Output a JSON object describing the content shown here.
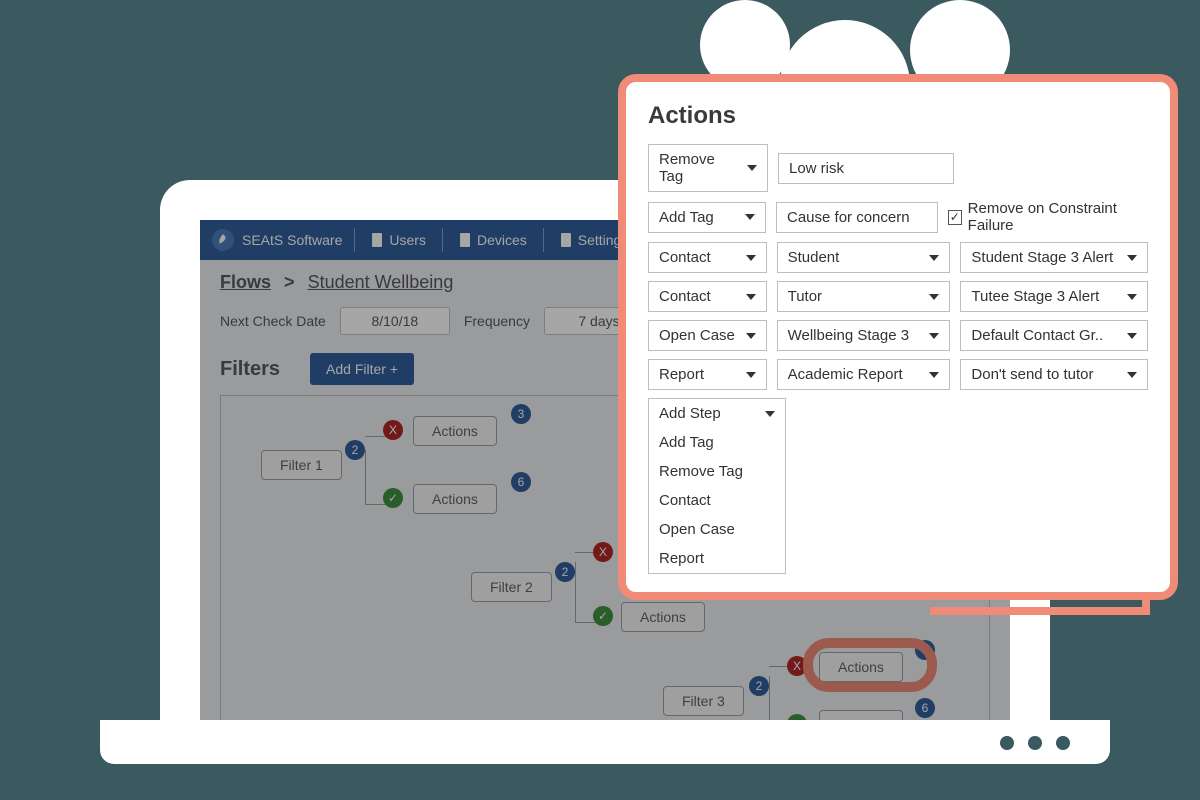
{
  "brand": "SEAtS Software",
  "nav": {
    "users": "Users",
    "devices": "Devices",
    "settings": "Settings"
  },
  "breadcrumb": {
    "flows": "Flows",
    "sep": ">",
    "current": "Student Wellbeing"
  },
  "controls": {
    "next_check_label": "Next Check Date",
    "next_check_value": "8/10/18",
    "frequency_label": "Frequency",
    "frequency_value": "7 days"
  },
  "filters": {
    "title": "Filters",
    "add_btn": "Add Filter +"
  },
  "flow": {
    "filter1": "Filter 1",
    "filter2": "Filter 2",
    "filter3": "Filter 3",
    "actions": "Actions",
    "count2": "2",
    "count3": "3",
    "count6": "6",
    "x": "X",
    "check": "✓"
  },
  "popup": {
    "title": "Actions",
    "rows": [
      {
        "a": "Remove Tag",
        "b_text": "Low risk"
      },
      {
        "a": "Add Tag",
        "b_text": "Cause for concern",
        "cb": "Remove on Constraint Failure"
      },
      {
        "a": "Contact",
        "b": "Student",
        "c": "Student Stage 3 Alert"
      },
      {
        "a": "Contact",
        "b": "Tutor",
        "c": "Tutee Stage 3 Alert"
      },
      {
        "a": "Open Case",
        "b": "Wellbeing Stage 3",
        "c": "Default Contact Gr.."
      },
      {
        "a": "Report",
        "b": "Academic Report",
        "c": "Don't send to tutor"
      }
    ],
    "step_menu": {
      "header": "Add Step",
      "items": [
        "Add Tag",
        "Remove Tag",
        "Contact",
        "Open Case",
        "Report"
      ]
    }
  }
}
